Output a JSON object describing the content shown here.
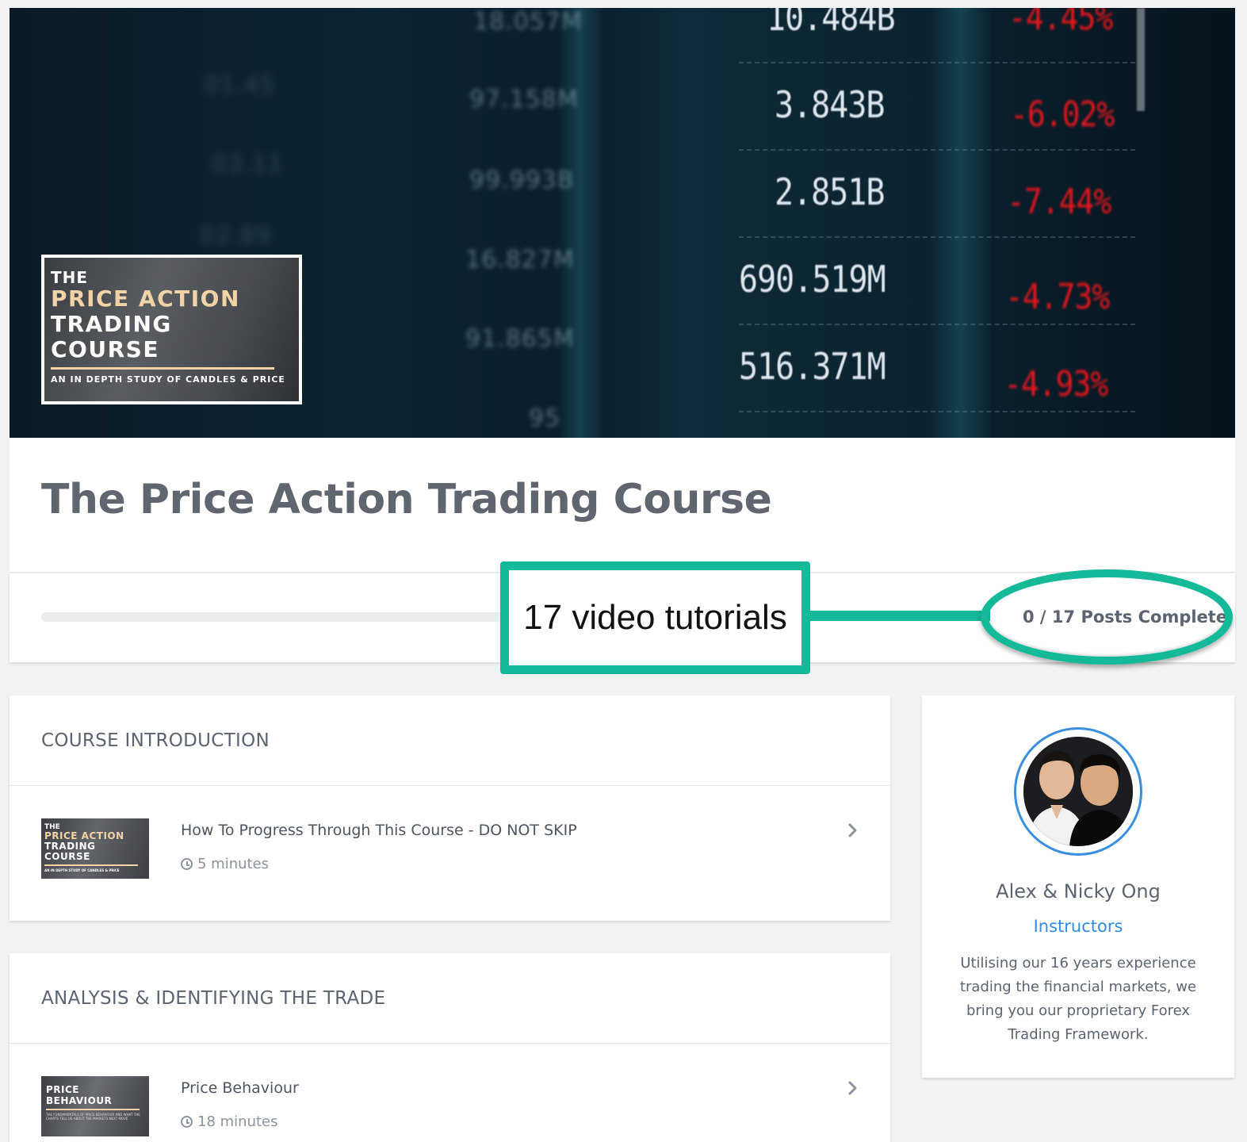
{
  "hero": {
    "ticker_numbers": [
      "10.484B",
      "3.843B",
      "2.851B",
      "690.519M",
      "516.371M"
    ],
    "ticker_percents": [
      "-4.45%",
      "-6.02%",
      "-7.44%",
      "-4.73%",
      "-4.93%"
    ],
    "thumbnail": {
      "line1": "THE",
      "line2": "PRICE ACTION",
      "line3": "TRADING",
      "line4": "COURSE",
      "tagline": "AN IN DEPTH STUDY OF CANDLES & PRICE"
    }
  },
  "course": {
    "title": "The Price Action Trading Course",
    "progress_percent": 0,
    "posts_complete": "0 / 17 Posts Complete"
  },
  "annotation": {
    "label": "17 video tutorials"
  },
  "sections": [
    {
      "heading": "COURSE INTRODUCTION",
      "lessons": [
        {
          "title": "How To Progress Through This Course - DO NOT SKIP",
          "duration": "5 minutes",
          "thumb": {
            "l1": "THE",
            "l2": "PRICE ACTION",
            "l3": "TRADING",
            "l4": "COURSE",
            "l5": "AN IN DEPTH STUDY OF CANDLES & PRICE"
          }
        }
      ]
    },
    {
      "heading": "ANALYSIS & IDENTIFYING THE TRADE",
      "lessons": [
        {
          "title": "Price Behaviour",
          "duration": "18 minutes",
          "thumb": {
            "l1": "PRICE",
            "l2": "BEHAVIOUR",
            "l3": "THE FUNDAMENTALS OF PRICE BEHAVIOUR AND WHAT THE CHARTS TELL US ABOUT THE MARKETS NEXT MOVE"
          }
        }
      ]
    }
  ],
  "instructor": {
    "name": "Alex & Nicky Ong",
    "role": "Instructors",
    "bio": "Utilising our 16 years experience trading the financial markets, we bring you our proprietary Forex Trading Framework."
  },
  "colors": {
    "accent_teal": "#14b99a",
    "link_blue": "#2f8de4",
    "ticker_red": "#e8161c"
  },
  "icons": [
    "clock-icon",
    "chevron-right-icon"
  ]
}
